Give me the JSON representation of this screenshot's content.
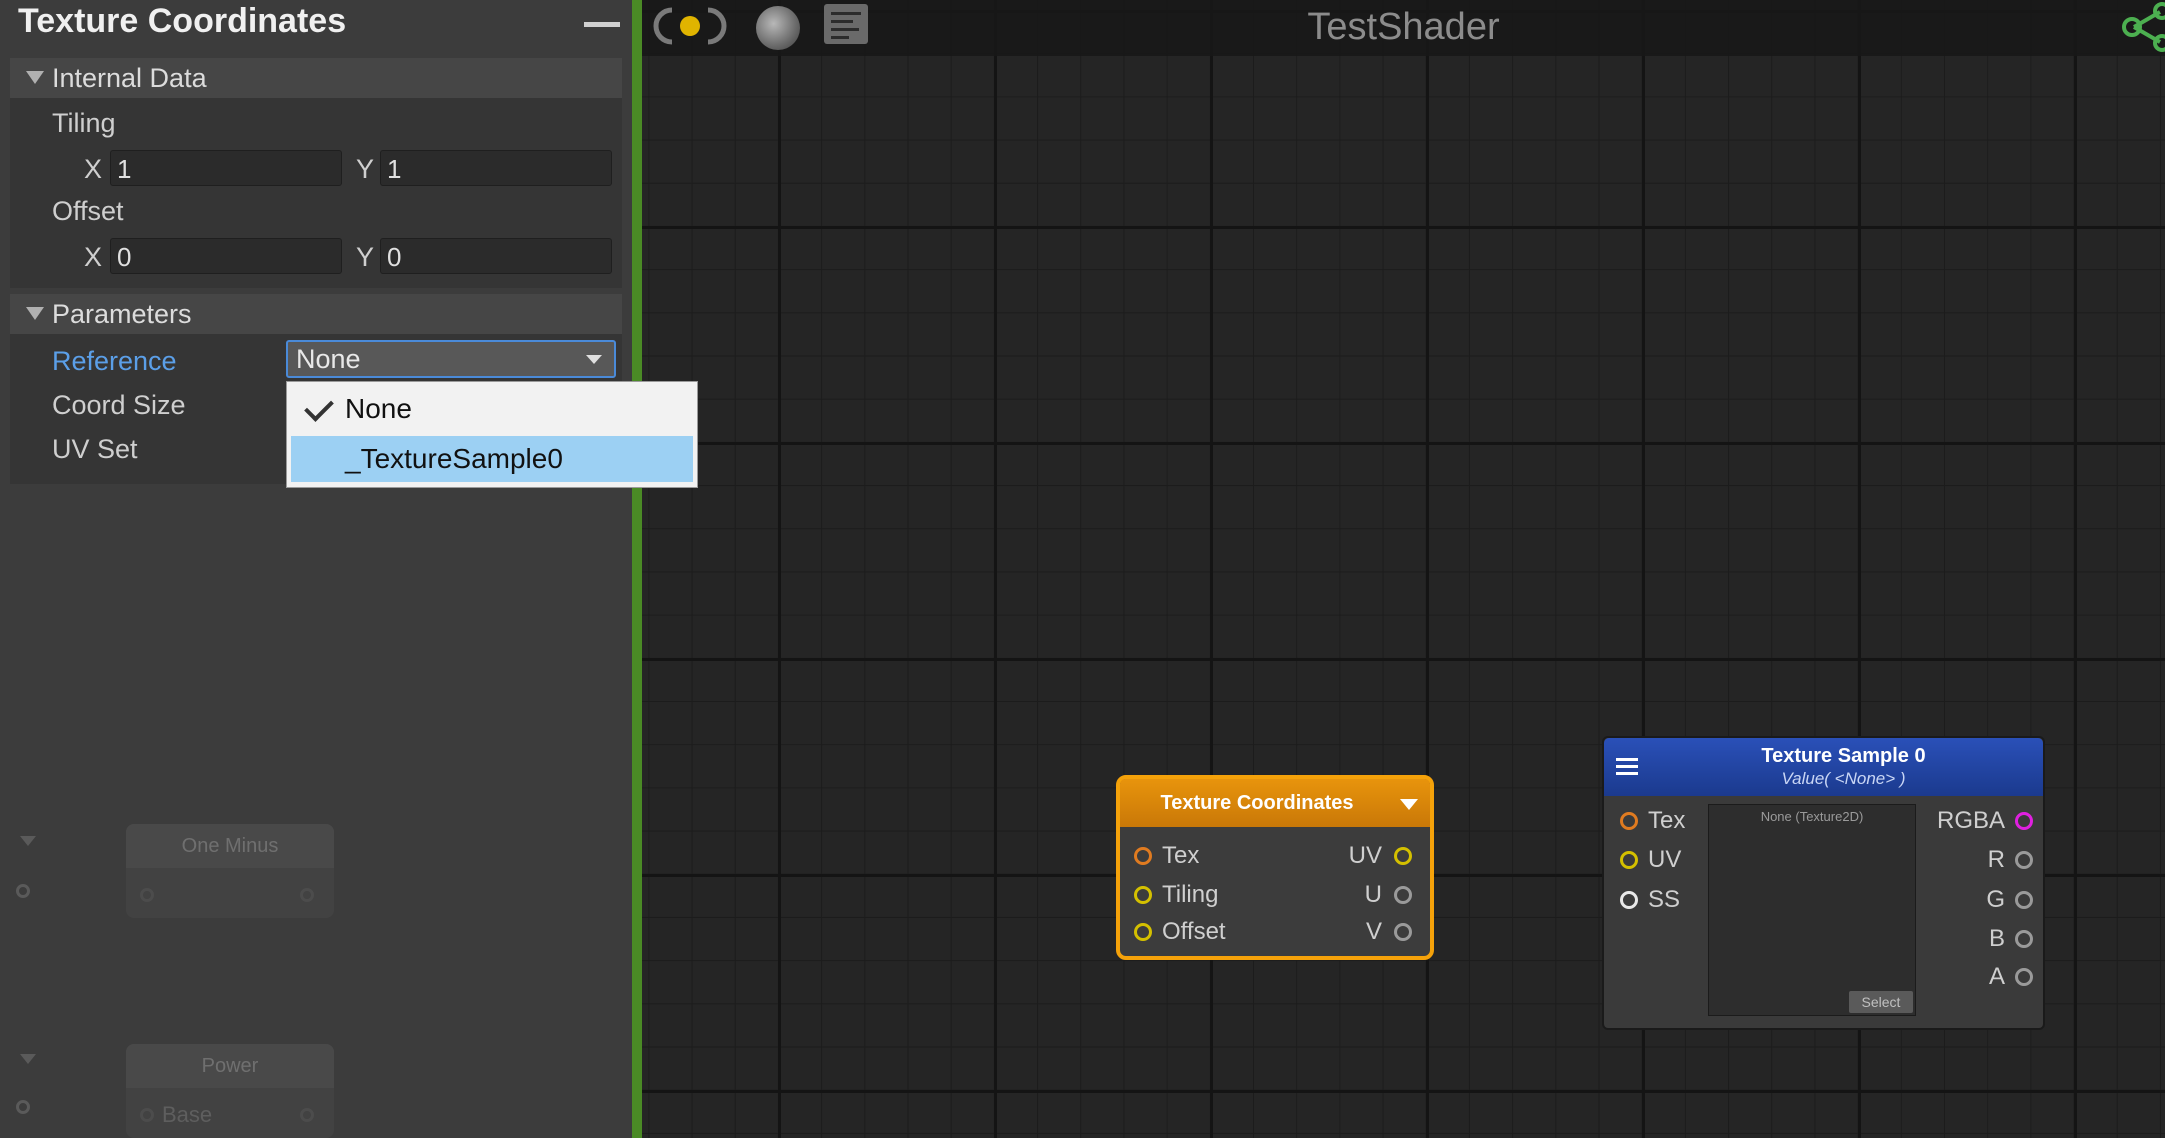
{
  "inspector": {
    "title": "Texture Coordinates",
    "internal_data": {
      "header": "Internal Data",
      "tiling_label": "Tiling",
      "tiling_x_label": "X",
      "tiling_x": "1",
      "tiling_y_label": "Y",
      "tiling_y": "1",
      "offset_label": "Offset",
      "offset_x_label": "X",
      "offset_x": "0",
      "offset_y_label": "Y",
      "offset_y": "0"
    },
    "parameters": {
      "header": "Parameters",
      "reference_label": "Reference",
      "reference_value": "None",
      "coord_size_label": "Coord Size",
      "uv_set_label": "UV Set"
    },
    "dropdown_options": [
      {
        "label": "None",
        "checked": true
      },
      {
        "label": "_TextureSample0",
        "highlighted": true
      }
    ],
    "faded_nodes": [
      {
        "label": "One Minus"
      },
      {
        "label": "Power",
        "port_label": "Base"
      }
    ]
  },
  "canvas": {
    "shader_name": "TestShader",
    "nodes": {
      "texture_coordinates": {
        "title": "Texture Coordinates",
        "inputs": [
          "Tex",
          "Tiling",
          "Offset"
        ],
        "outputs": [
          "UV",
          "U",
          "V"
        ]
      },
      "texture_sample": {
        "title": "Texture Sample 0",
        "subtitle": "Value( <None> )",
        "inputs": [
          "Tex",
          "UV",
          "SS"
        ],
        "outputs": [
          "RGBA",
          "R",
          "G",
          "B",
          "A"
        ],
        "preview_label": "None (Texture2D)",
        "select_label": "Select"
      }
    }
  },
  "colors": {
    "accent_blue": "#4a8ad8",
    "node_orange": "#f5a20a",
    "node_blue": "#1b3a8e",
    "divider_green": "#4a8a25",
    "port_yellow": "#d4c000",
    "port_orange": "#e07b20",
    "port_magenta": "#e020e0"
  }
}
